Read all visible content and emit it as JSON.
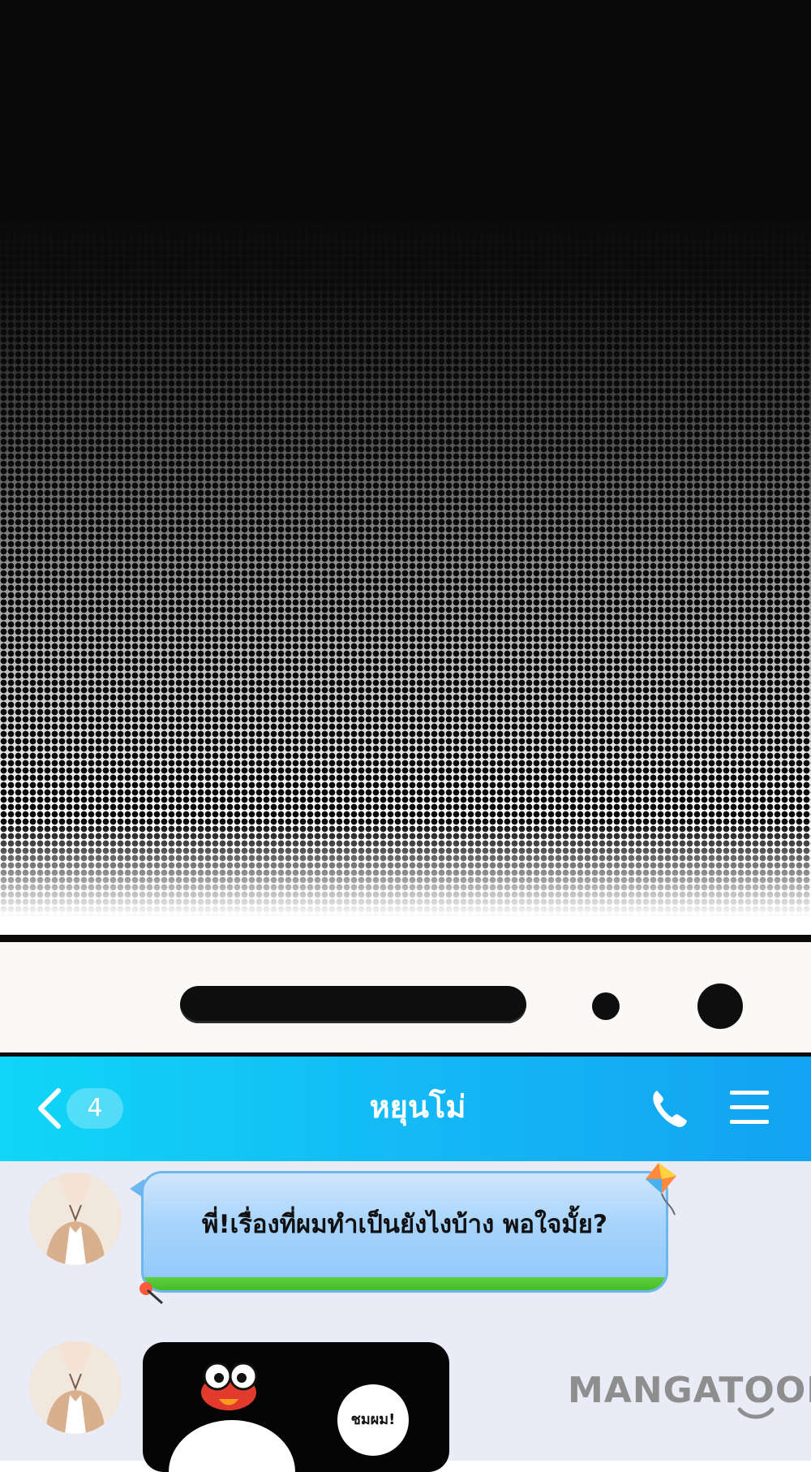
{
  "header": {
    "back_badge": "4",
    "title": "หยุนโม่"
  },
  "messages": [
    {
      "type": "text",
      "text": "พี่!เรื่องที่ผมทำเป็นยังไงบ้าง พอใจมั้ย?"
    },
    {
      "type": "sticker",
      "caption": "ชมผม!"
    }
  ],
  "watermark": "MANGATOON",
  "colors": {
    "header_start": "#10d6f7",
    "header_end": "#12a3f2",
    "chat_background": "#e9ecf7",
    "bubble": "#a6d3fb"
  }
}
